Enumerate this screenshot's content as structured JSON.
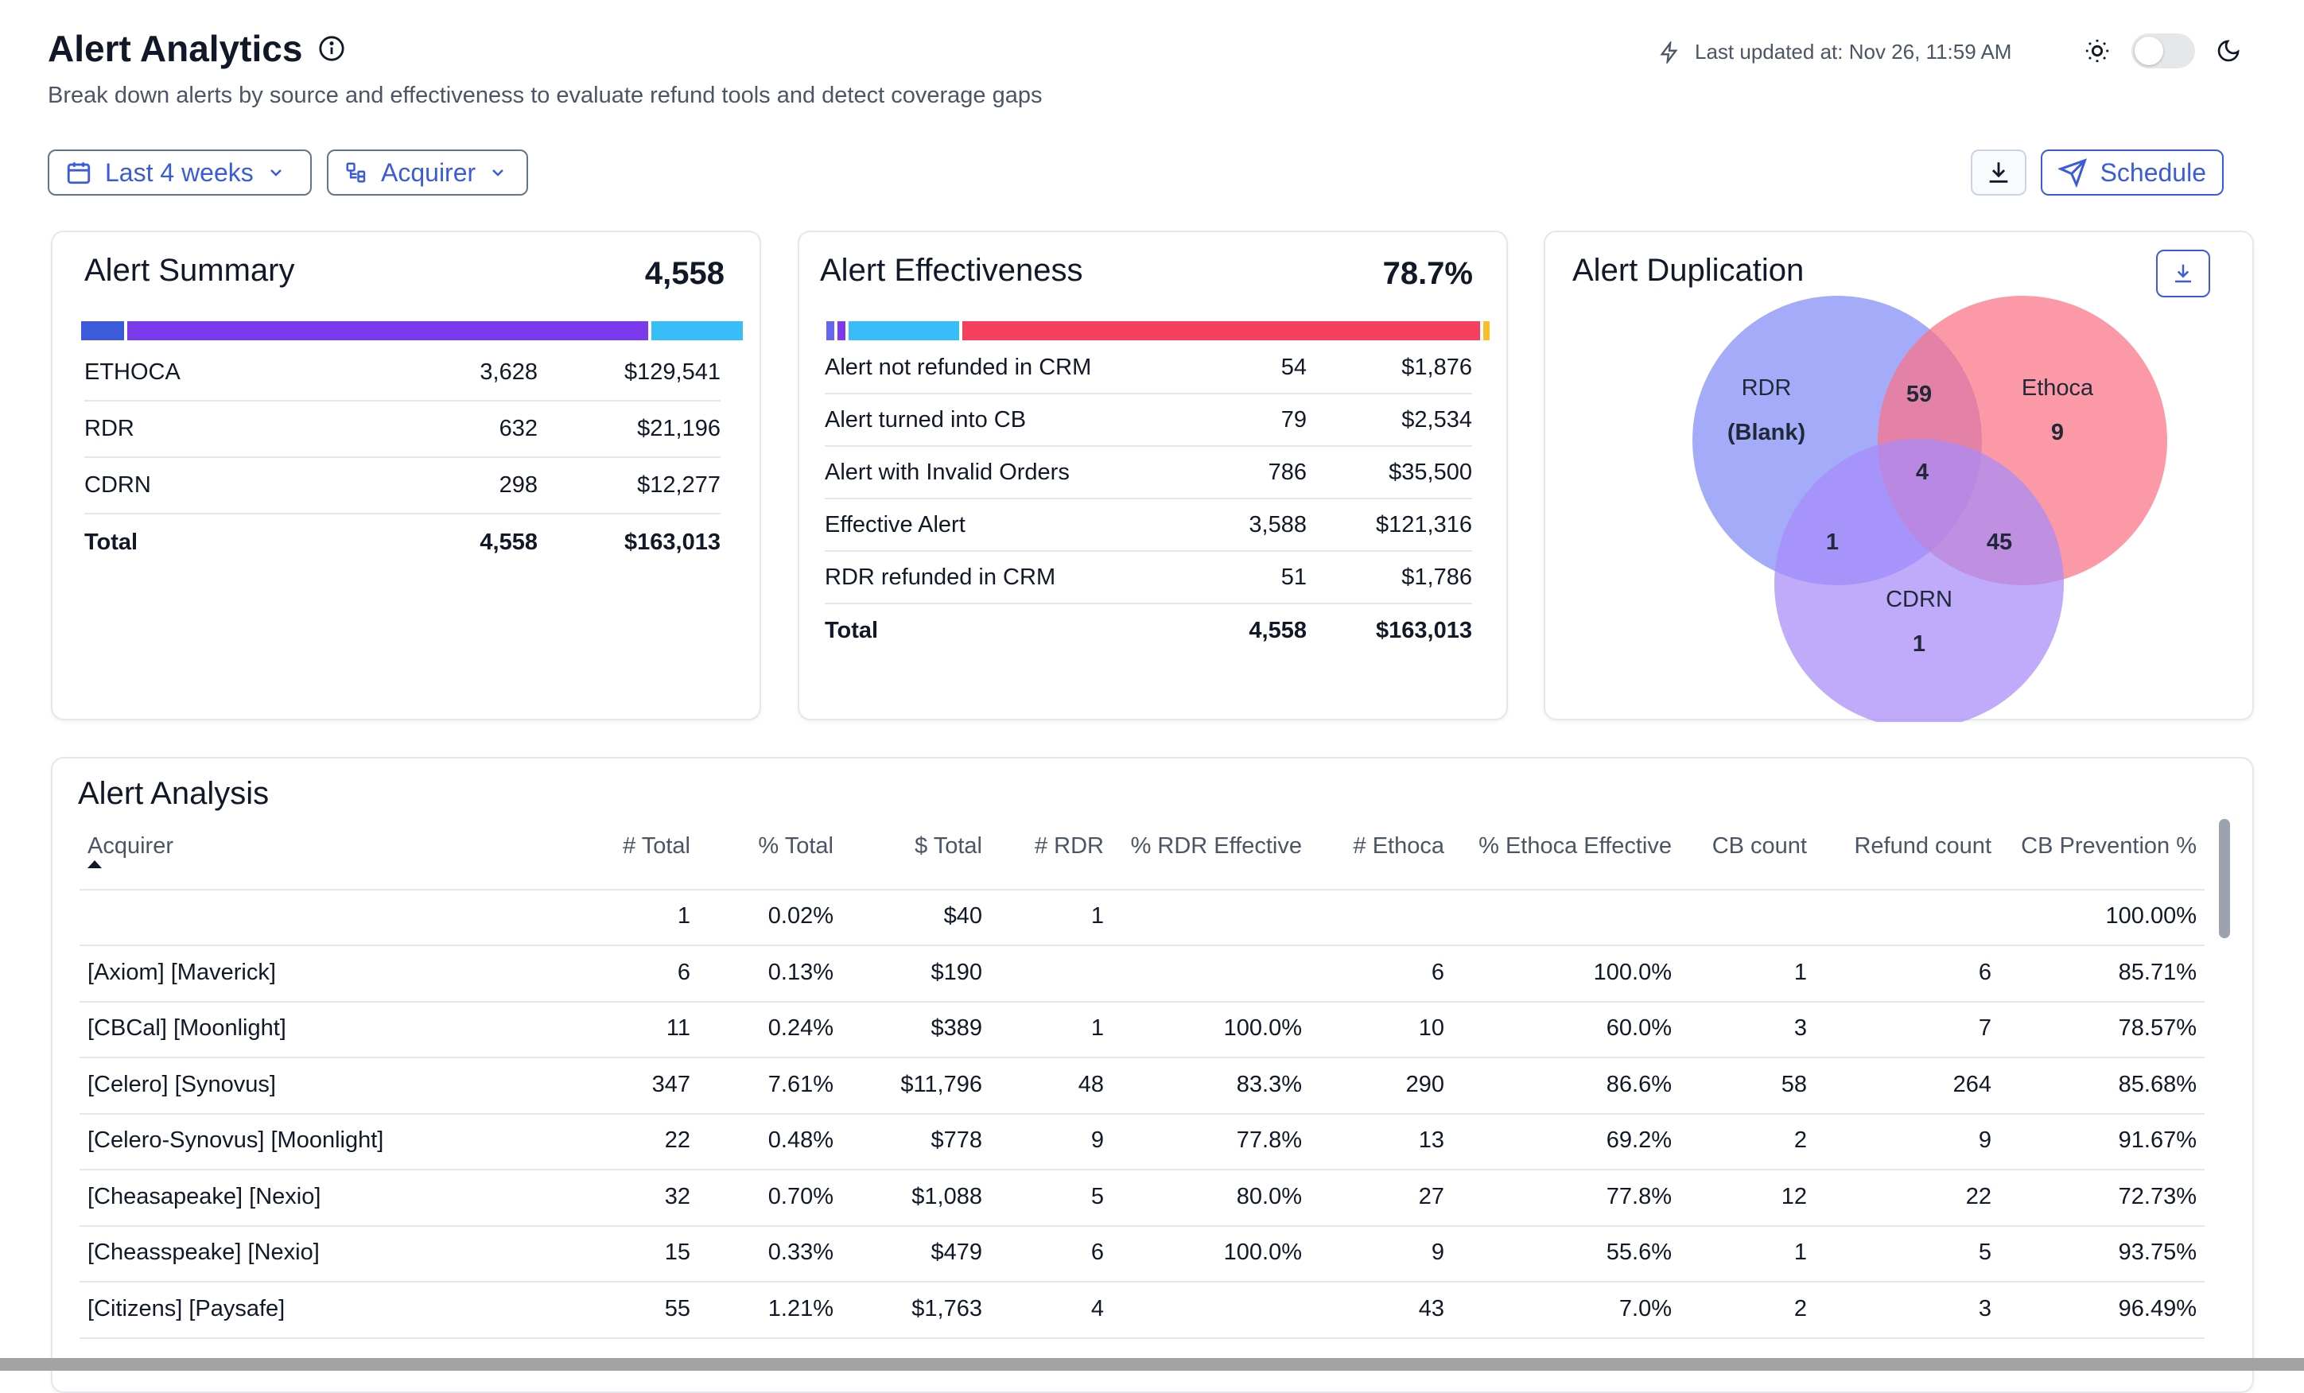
{
  "header": {
    "title": "Alert Analytics",
    "subtitle": "Break down alerts by source and effectiveness to evaluate refund tools and detect coverage gaps",
    "last_updated": "Last updated at: Nov 26, 11:59 AM"
  },
  "filters": {
    "date_range": "Last 4 weeks",
    "group_by": "Acquirer",
    "schedule_label": "Schedule"
  },
  "summary": {
    "title": "Alert Summary",
    "total": "4,558",
    "bar": [
      {
        "color": "#3b5bdb",
        "fraction": 0.065
      },
      {
        "color": "#7c3aed",
        "fraction": 0.796
      },
      {
        "color": "#38bdf8",
        "fraction": 0.139
      }
    ],
    "rows": [
      {
        "label": "ETHOCA",
        "count": "3,628",
        "amount": "$129,541"
      },
      {
        "label": "RDR",
        "count": "632",
        "amount": "$21,196"
      },
      {
        "label": "CDRN",
        "count": "298",
        "amount": "$12,277"
      },
      {
        "label": "Total",
        "count": "4,558",
        "amount": "$163,013"
      }
    ]
  },
  "effectiveness": {
    "title": "Alert Effectiveness",
    "total": "78.7%",
    "bar": [
      {
        "color": "#6366f1",
        "fraction": 0.012
      },
      {
        "color": "#7c3aed",
        "fraction": 0.012
      },
      {
        "color": "#38bdf8",
        "fraction": 0.17
      },
      {
        "color": "#f43f5e",
        "fraction": 0.796
      },
      {
        "color": "#fbbf24",
        "fraction": 0.01
      }
    ],
    "rows": [
      {
        "label": "Alert not refunded in CRM",
        "count": "54",
        "amount": "$1,876"
      },
      {
        "label": "Alert turned into CB",
        "count": "79",
        "amount": "$2,534"
      },
      {
        "label": "Alert with Invalid Orders",
        "count": "786",
        "amount": "$35,500"
      },
      {
        "label": "Effective Alert",
        "count": "3,588",
        "amount": "$121,316"
      },
      {
        "label": "RDR refunded in CRM",
        "count": "51",
        "amount": "$1,786"
      },
      {
        "label": "Total",
        "count": "4,558",
        "amount": "$163,013"
      }
    ]
  },
  "duplication": {
    "title": "Alert Duplication",
    "rdr_label": "RDR",
    "rdr_value": "(Blank)",
    "ethoca_label": "Ethoca",
    "ethoca_value": "9",
    "cdrn_label": "CDRN",
    "cdrn_value": "1",
    "rdr_ethoca": "59",
    "all_three": "4",
    "rdr_cdrn": "1",
    "ethoca_cdrn": "45",
    "colors": {
      "rdr": "#818cf8",
      "ethoca": "#fb7185",
      "cdrn": "#a78bfa"
    }
  },
  "analysis": {
    "title": "Alert Analysis",
    "columns": [
      "Acquirer",
      "# Total",
      "% Total",
      "$ Total",
      "# RDR",
      "% RDR Effective",
      "# Ethoca",
      "% Ethoca Effective",
      "CB count",
      "Refund count",
      "CB Prevention %"
    ],
    "rows": [
      [
        "",
        "1",
        "0.02%",
        "$40",
        "1",
        "",
        "",
        "",
        "",
        "",
        "100.00%"
      ],
      [
        "[Axiom] [Maverick]",
        "6",
        "0.13%",
        "$190",
        "",
        "",
        "6",
        "100.0%",
        "1",
        "6",
        "85.71%"
      ],
      [
        "[CBCal] [Moonlight]",
        "11",
        "0.24%",
        "$389",
        "1",
        "100.0%",
        "10",
        "60.0%",
        "3",
        "7",
        "78.57%"
      ],
      [
        "[Celero] [Synovus]",
        "347",
        "7.61%",
        "$11,796",
        "48",
        "83.3%",
        "290",
        "86.6%",
        "58",
        "264",
        "85.68%"
      ],
      [
        "[Celero-Synovus] [Moonlight]",
        "22",
        "0.48%",
        "$778",
        "9",
        "77.8%",
        "13",
        "69.2%",
        "2",
        "9",
        "91.67%"
      ],
      [
        "[Cheasapeake] [Nexio]",
        "32",
        "0.70%",
        "$1,088",
        "5",
        "80.0%",
        "27",
        "77.8%",
        "12",
        "22",
        "72.73%"
      ],
      [
        "[Cheasspeake] [Nexio]",
        "15",
        "0.33%",
        "$479",
        "6",
        "100.0%",
        "9",
        "55.6%",
        "1",
        "5",
        "93.75%"
      ],
      [
        "[Citizens] [Paysafe]",
        "55",
        "1.21%",
        "$1,763",
        "4",
        "",
        "43",
        "7.0%",
        "2",
        "3",
        "96.49%"
      ]
    ]
  }
}
